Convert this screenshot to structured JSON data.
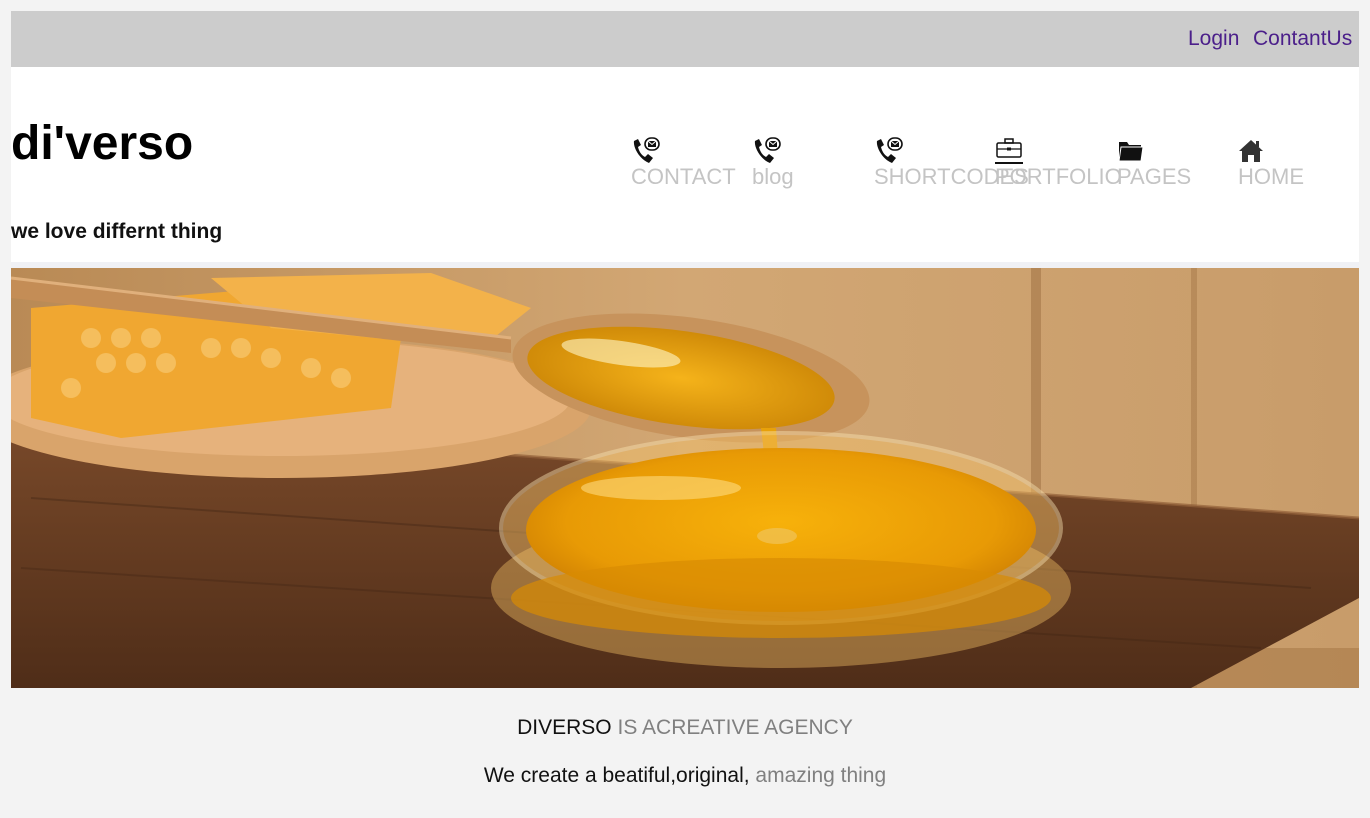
{
  "topbar": {
    "login": "Login",
    "contact_us": "ContantUs"
  },
  "brand": {
    "name": "di'verso",
    "tagline": "we love differnt thing"
  },
  "nav": {
    "items": [
      {
        "label": "CONTACT",
        "icon": "phone-mail-icon"
      },
      {
        "label": "blog",
        "icon": "phone-mail-icon"
      },
      {
        "label": "SHORTCODES",
        "icon": "phone-mail-icon"
      },
      {
        "label": "PORTFOLIO",
        "icon": "briefcase-icon"
      },
      {
        "label": "PAGES",
        "icon": "folder-icon"
      },
      {
        "label": "HOME",
        "icon": "home-icon"
      }
    ]
  },
  "hero": {
    "image": "honey-spoon-photo"
  },
  "intro": {
    "name": "DIVERSO",
    "headline": "IS ACREATIVE AGENCY",
    "lead": "We create a beatiful,original,",
    "highlight": "amazing thing"
  },
  "colors": {
    "topbar_bg": "#cccccc",
    "link": "#4b1f8a",
    "nav_label": "#c4c4c4",
    "muted": "#808080",
    "page_bg": "#f3f3f3"
  }
}
